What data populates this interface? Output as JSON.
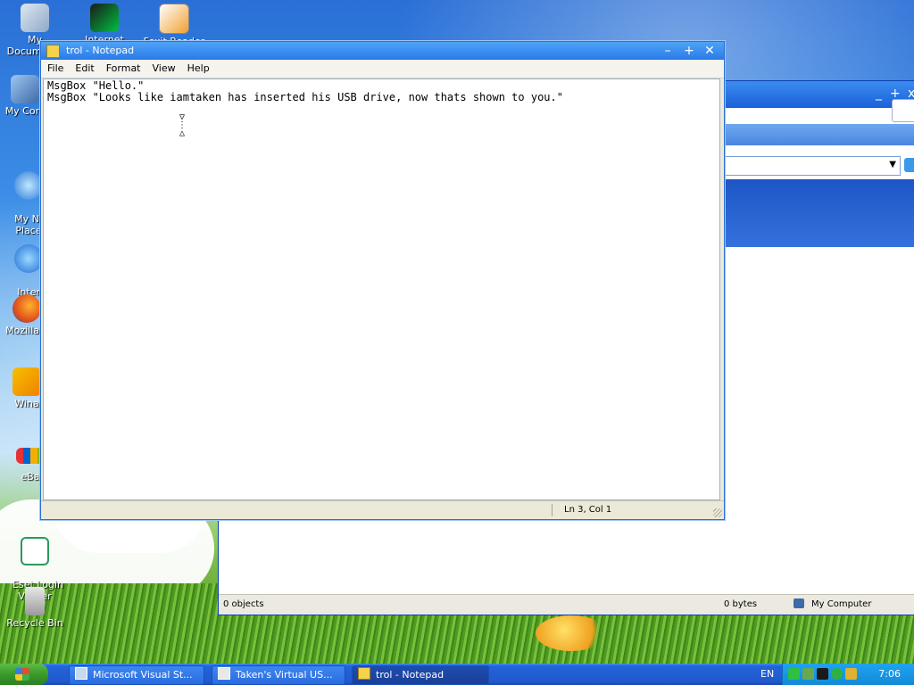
{
  "desktop": {
    "icons": [
      {
        "label": "My Documents"
      },
      {
        "label": "Internet"
      },
      {
        "label": "Foxit Reader"
      },
      {
        "label": "My Com"
      },
      {
        "label": "My Net\nPlace"
      },
      {
        "label": "Intern\nExplo"
      },
      {
        "label": "Mozilla F"
      },
      {
        "label": "Wina"
      },
      {
        "label": "eBa"
      },
      {
        "label": "Eset Login\nViewer"
      },
      {
        "label": "Recycle Bin"
      }
    ]
  },
  "explorer": {
    "status_objects": "0 objects",
    "status_size": "0 bytes",
    "status_location": "My Computer"
  },
  "notepad": {
    "title": "trol - Notepad",
    "menu": [
      "File",
      "Edit",
      "Format",
      "View",
      "Help"
    ],
    "content": "MsgBox \"Hello.\"\nMsgBox \"Looks like iamtaken has inserted his USB drive, now thats shown to you.\"",
    "status_position": "Ln 3, Col 1"
  },
  "taskbar": {
    "tasks": [
      {
        "label": "Microsoft Visual St..."
      },
      {
        "label": "Taken's Virtual US..."
      },
      {
        "label": "trol - Notepad"
      }
    ],
    "language": "EN",
    "clock": "7:06"
  },
  "colors": {
    "accent": "#2a6fd6",
    "taskbar": "#2157cc",
    "start": "#3a9a2b"
  }
}
